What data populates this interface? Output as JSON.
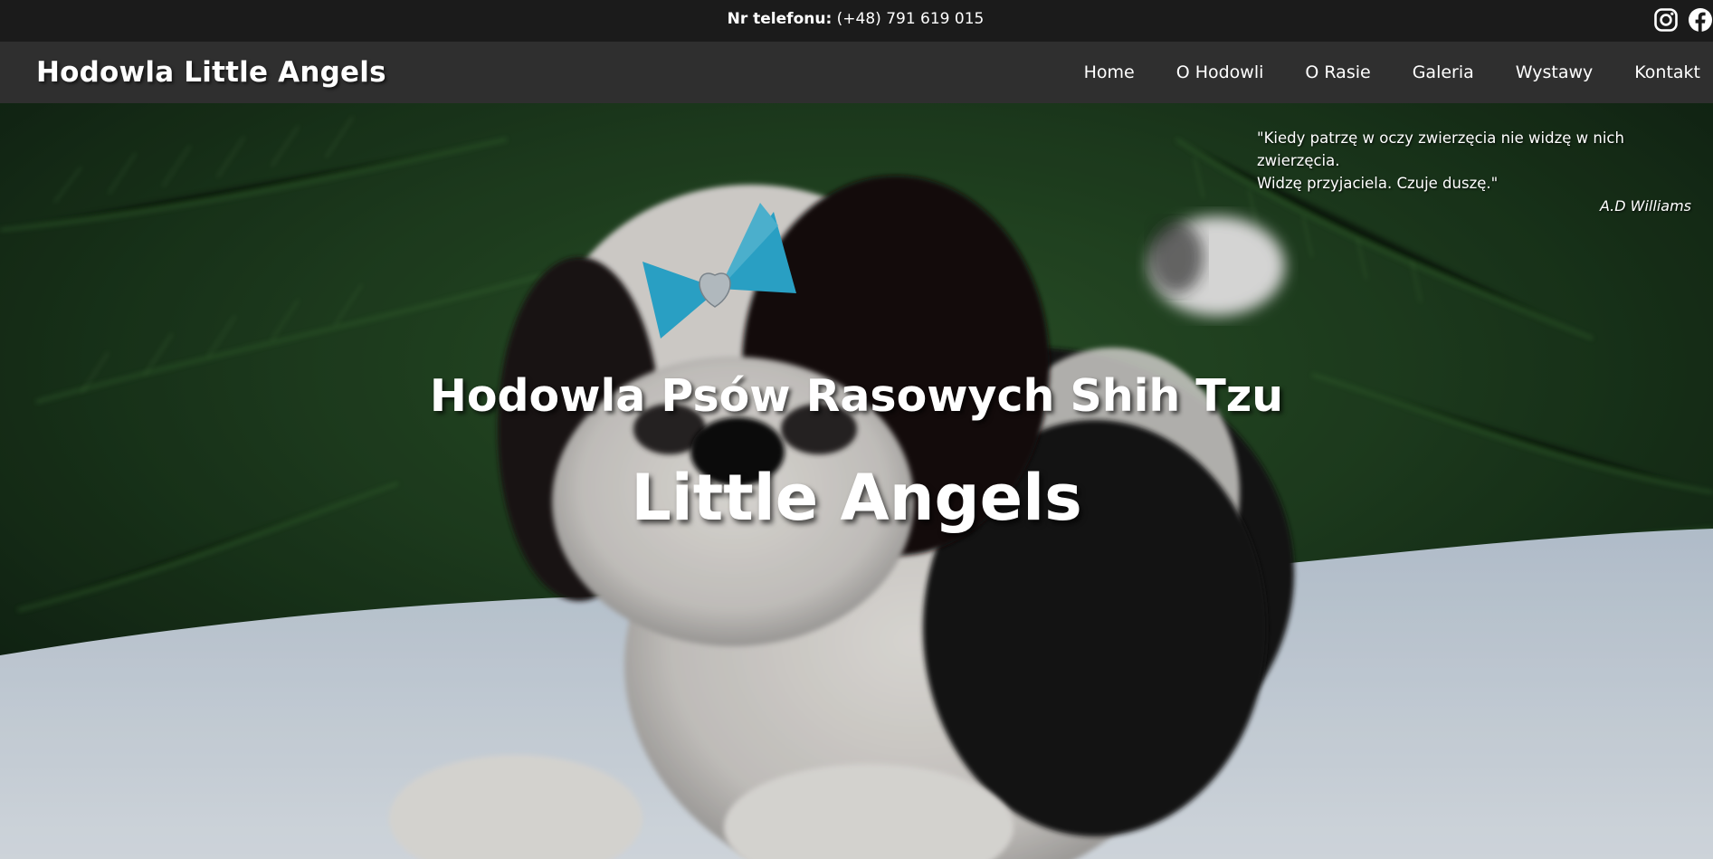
{
  "topbar": {
    "phone_label": "Nr telefonu:",
    "phone_number": "(+48) 791 619 015",
    "social": [
      {
        "icon": "instagram-icon"
      },
      {
        "icon": "facebook-icon"
      }
    ]
  },
  "navbar": {
    "brand": "Hodowla Little Angels",
    "menu": [
      {
        "label": "Home"
      },
      {
        "label": "O Hodowli"
      },
      {
        "label": "O Rasie"
      },
      {
        "label": "Galeria"
      },
      {
        "label": "Wystawy"
      },
      {
        "label": "Kontakt"
      }
    ]
  },
  "hero": {
    "quote_line1": "\"Kiedy patrzę w oczy zwierzęcia nie widzę w nich zwierzęcia.",
    "quote_line2": "Widzę przyjaciela. Czuje duszę.\"",
    "quote_author": "A.D Williams",
    "headline": "Hodowla Psów Rasowych Shih Tzu",
    "title": "Little Angels"
  },
  "colors": {
    "topbar_bg": "#1b1b1b",
    "navbar_bg": "#2f2f2f",
    "text": "#ffffff",
    "bow": "#2fb6df"
  }
}
